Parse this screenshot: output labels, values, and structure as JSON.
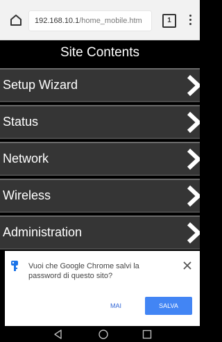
{
  "browser": {
    "url_host": "192.168.10.1",
    "url_path": "/home_mobile.htm",
    "tab_count": "1"
  },
  "page": {
    "title": "Site Contents",
    "menu": [
      {
        "label": "Setup Wizard"
      },
      {
        "label": "Status"
      },
      {
        "label": "Network"
      },
      {
        "label": "Wireless"
      },
      {
        "label": "Administration"
      }
    ]
  },
  "password_prompt": {
    "message": "Vuoi che Google Chrome salvi la password di questo sito?",
    "never_label": "MAI",
    "save_label": "SALVA"
  },
  "colors": {
    "accent": "#4285f4",
    "key_icon": "#1a73e8",
    "menu_bg": "#353535"
  },
  "icons": [
    "home-icon",
    "tab-count-icon",
    "overflow-menu-icon",
    "chevron-right-icon",
    "key-icon",
    "close-icon",
    "back-icon",
    "home-circle-icon",
    "recent-apps-icon"
  ]
}
